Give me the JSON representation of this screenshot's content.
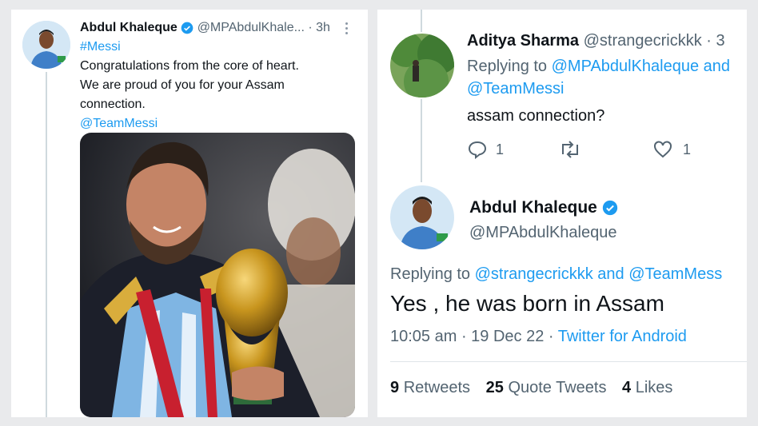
{
  "left_tweet": {
    "author_name": "Abdul Khaleque",
    "author_handle": "@MPAbdulKhale...",
    "separator": "·",
    "time": "3h",
    "hashtag": "#Messi",
    "text_line1": "Congratulations from the core of heart.",
    "text_line2": "We are proud of you for your Assam",
    "text_line3": "connection.",
    "mention": "@TeamMessi"
  },
  "right_reply": {
    "author_name": "Aditya Sharma",
    "author_handle": "@strangecrickkk · 3",
    "replying_prefix": "Replying to",
    "replying_to1": "@MPAbdulKhaleque and",
    "replying_to2": "@TeamMessi",
    "text": "assam connection?",
    "reply_count": "1",
    "like_count": "1"
  },
  "main_tweet": {
    "author_name": "Abdul Khaleque",
    "author_handle": "@MPAbdulKhaleque",
    "replying_prefix": "Replying to",
    "replying_to": "@strangecrickkk and @TeamMess",
    "text": "Yes , he was born in Assam",
    "timestamp": "10:05 am · 19 Dec 22 · ",
    "source": "Twitter for Android",
    "retweets_count": "9",
    "retweets_label": "Retweets",
    "quotes_count": "25",
    "quotes_label": "Quote Tweets",
    "likes_count": "4",
    "likes_label": "Likes"
  },
  "colors": {
    "accent": "#1d9bf0",
    "secondary_text": "#536471",
    "primary_text": "#0f1419"
  },
  "icons": [
    "verified-badge-icon",
    "more-options-icon",
    "reply-icon",
    "retweet-icon",
    "like-icon"
  ]
}
